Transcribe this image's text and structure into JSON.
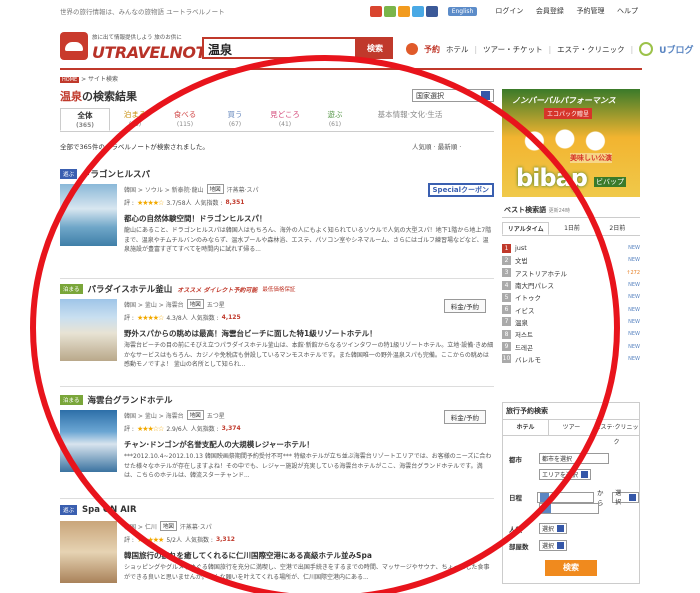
{
  "topbar": {
    "tagline": "世界の旅行情報は、みんなの旅物語 ユートラベルノート",
    "english": "English",
    "links": [
      "ログイン",
      "会員登録",
      "予約管理",
      "ヘルプ"
    ]
  },
  "header": {
    "logo_sub": "旅に出て情報提供しよう 旅のお供に",
    "logo_name": "UTRAVELNOTE",
    "search_value": "温泉",
    "search_button": "検索",
    "yoyaku": "予約",
    "nav": [
      "ホテル",
      "ツアー・チケット",
      "エステ・クリニック"
    ],
    "ublog": "Uブログ"
  },
  "breadcrumb": {
    "home": "HOME",
    "current": "> サイト検索"
  },
  "results": {
    "keyword": "温泉",
    "suffix": "の検索結果",
    "country_select": "国家選択",
    "tabs": [
      {
        "label": "全体",
        "count": "(365)"
      },
      {
        "label": "泊まる",
        "count": "(65)"
      },
      {
        "label": "食べる",
        "count": "(115)"
      },
      {
        "label": "買う",
        "count": "(67)"
      },
      {
        "label": "見どころ",
        "count": "(41)"
      },
      {
        "label": "遊ぶ",
        "count": "(61)"
      }
    ],
    "basic_tab": "基本情報·文化·生活",
    "count_line": "全部で365件のトラベルノートが検索されました。",
    "sort": "人気順 · 最新順 ·"
  },
  "listings": [
    {
      "category": "遊ぶ",
      "title": "ドラゴンヒルスパ",
      "meta": "韓国 > ソウル > 新泰院·龍山",
      "map": "地図",
      "type": "汗蒸幕·スパ",
      "score": "3.7/58人",
      "views_label": "人気指数 :",
      "views": "8,351",
      "special": "Specialクーポン",
      "headline": "都心の自然体験空間！ドラゴンヒルスパ！",
      "desc": "龍山にあること、ドラゴンヒルスパは韓国人はもちろん、海外の人にもよく知られているソウルで人気の大型スパ！地下1階から地上7階まで、温泉やチムチルバンのみならず、温水プールや森林浴、エステ、パソコン室やシネマルーム、さらにはゴルフ練習場などなど、温泉施設が豊富すぎてすべてを時間内に試れず帰る..."
    },
    {
      "category": "泊まる",
      "title": "パラダイスホテル釜山",
      "promo1": "オススメ ダイレクト予約可能",
      "promo2": "最低価格保証",
      "meta": "韓国 > 釜山 > 海雲台",
      "map": "地図",
      "type": "五つ星",
      "score": "4.3/8人",
      "views_label": "人気指数 :",
      "views": "4,125",
      "price": "料金/予約",
      "headline": "野外スパからの眺めは最高！海雲台ビーチに面した特1級リゾートホテル！",
      "desc": "海雲台ビーチの目の前にそびえ立つパラダイスホテル釜山は、本館·新館からなるツインタワーの特1級リゾートホテル。立地·設備·きめ細かなサービスはもちろん、カジノや免税店も併設しているマンモスホテルです。また韓国唯一の野外温泉スパも完備。ここからの眺めは感動モノですよ！ 釜山の名所として知られ..."
    },
    {
      "category": "泊まる",
      "title": "海雲台グランドホテル",
      "meta": "韓国 > 釜山 > 海雲台",
      "map": "地図",
      "type": "五つ星",
      "score": "2.9/6人",
      "views_label": "人気指数 :",
      "views": "3,374",
      "price": "料金/予約",
      "headline": "チャン·ドンゴンが名誉支配人の大規模レジャーホテル！",
      "desc": "***2012.10.4~2012.10.13 韓国映画祭期間予約受付不可*** 特級ホテルが立ち並ぶ海雲台リゾートエリアでは、お客様のニーズに合わせた様々なホテルが存在しますよね！その中でも、レジャー施設が充実している海雲台ホテルがここ、海雲台グランドホテルです。満は、こちらのホテルは、韓流スターチャンド..."
    },
    {
      "category": "遊ぶ",
      "title": "Spa ON AIR",
      "meta": "韓国 > 仁川",
      "map": "地図",
      "type": "汗蒸幕·スパ",
      "score": "5/2人",
      "views_label": "人気指数 :",
      "views": "3,312",
      "headline": "韓国旅行の疲れを癒してくれるに仁川国際空港にある高級ホテル並みSpa",
      "desc": "ショッピングやグルメをめぐる韓国旅行を充分に満喫し、空港で出国手続きをするまでの時間、マッサージやサウナ、ちょっとした食事ができる良いと思いませんか。そんな願いを叶えてくれる場所が、仁川国際空港内にある..."
    }
  ],
  "ad": {
    "headline": "ノンバーバルパフォーマンス",
    "eco": "エコパック贈呈",
    "kouen": "美味しい公演",
    "logo": "bibap",
    "logo_sub": "ビバップ"
  },
  "best": {
    "title": "ベスト検索語",
    "updated": "更新24時",
    "tabs": [
      "リアルタイム",
      "1日前",
      "2日前"
    ],
    "items": [
      {
        "rank": "1",
        "name": "just",
        "change": "NEW"
      },
      {
        "rank": "2",
        "name": "文법",
        "change": "NEW"
      },
      {
        "rank": "3",
        "name": "アストリアホテル",
        "change": "↑272"
      },
      {
        "rank": "4",
        "name": "南大門パレス",
        "change": "NEW"
      },
      {
        "rank": "5",
        "name": "イトゥク",
        "change": "NEW"
      },
      {
        "rank": "6",
        "name": "イビス",
        "change": "NEW"
      },
      {
        "rank": "7",
        "name": "温泉",
        "change": "NEW"
      },
      {
        "rank": "8",
        "name": "저스트",
        "change": "NEW"
      },
      {
        "rank": "9",
        "name": "드레곤",
        "change": "NEW"
      },
      {
        "rank": "10",
        "name": "バレルモ",
        "change": "NEW"
      }
    ]
  },
  "booking": {
    "title": "旅行予約検索",
    "tabs": [
      "ホテル",
      "ツアー",
      "エステ·クリニック"
    ],
    "city_label": "都市",
    "city_select": "都市を選択",
    "area_select": "エリアを選択",
    "date_label": "日程",
    "from": "から",
    "select": "選択",
    "people_label": "人数",
    "rooms_label": "部屋数",
    "button": "検索"
  },
  "colors": {
    "brand": "#c0392b",
    "annotation": "#e8141c",
    "accent_blue": "#3a5fb0"
  }
}
